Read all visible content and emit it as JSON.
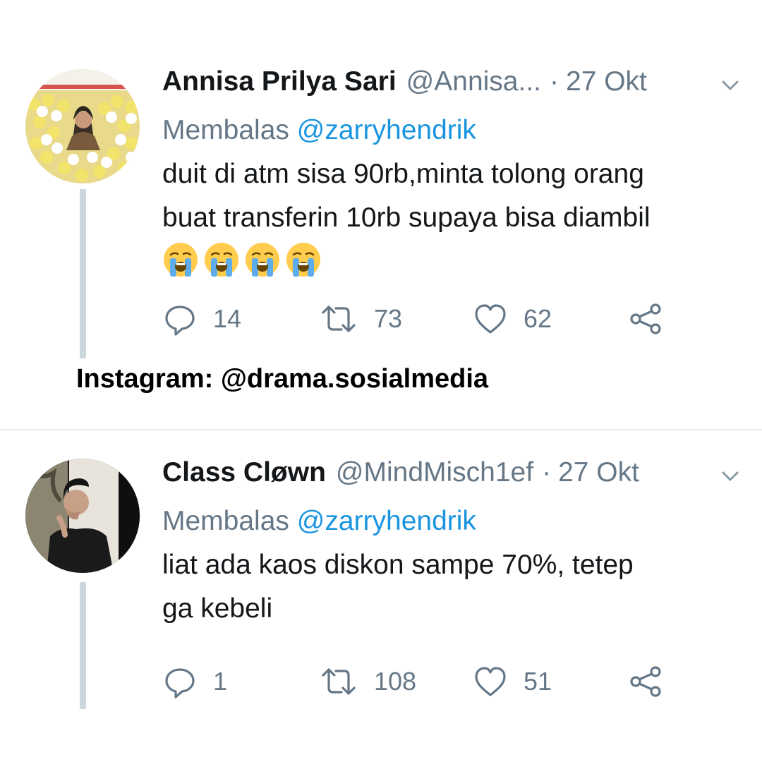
{
  "tweets": [
    {
      "name": "Annisa Prilya Sari",
      "handle": "@Annisa...",
      "separator": "·",
      "date": "27 Okt",
      "reply_prefix": "Membalas",
      "reply_to": "@zarryhendrik",
      "text_line1": "duit di atm sisa 90rb,minta tolong orang",
      "text_line2": "buat transferin 10rb supaya bisa diambil",
      "emojis": [
        "😭",
        "😭",
        "😭",
        "😭"
      ],
      "replies": "14",
      "retweets": "73",
      "likes": "62"
    },
    {
      "name": "Class Cløwn",
      "handle": "@MindMisch1ef",
      "separator": "·",
      "date": "27 Okt",
      "reply_prefix": "Membalas",
      "reply_to": "@zarryhendrik",
      "text_line1": "liat ada kaos diskon sampe 70%, tetep",
      "text_line2": "ga kebeli",
      "replies": "1",
      "retweets": "108",
      "likes": "51"
    }
  ],
  "watermark": "Instagram: @drama.sosialmedia",
  "colors": {
    "text": "#14171a",
    "secondary": "#657786",
    "link": "#1b95e0",
    "thread_line": "#ccd6dd",
    "divider": "#e6ecf0"
  },
  "icons": {
    "reply": "reply-icon",
    "retweet": "retweet-icon",
    "like": "heart-icon",
    "share": "share-icon",
    "menu": "chevron-down-icon"
  }
}
